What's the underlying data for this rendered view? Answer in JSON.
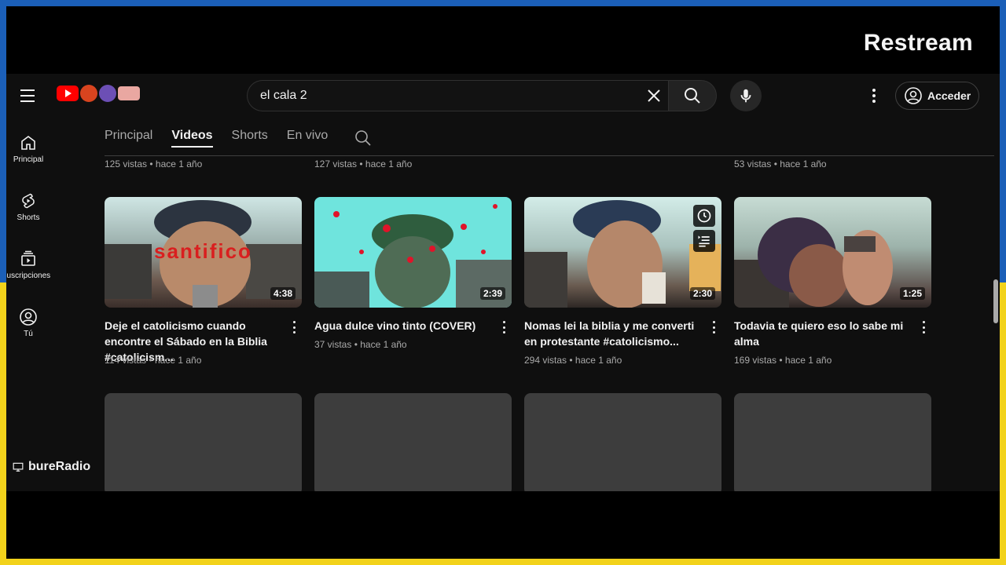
{
  "overlay": {
    "brand": "Restream",
    "channel": "bureRadio"
  },
  "search": {
    "value": "el cala 2"
  },
  "header": {
    "signin_label": "Acceder"
  },
  "sidebar": {
    "items": [
      {
        "label": "Principal",
        "icon": "home-icon"
      },
      {
        "label": "Shorts",
        "icon": "shorts-icon"
      },
      {
        "label": "Suscripciones",
        "icon": "subscriptions-icon"
      },
      {
        "label": "Tú",
        "icon": "account-icon"
      }
    ]
  },
  "tabs": [
    {
      "label": "Principal",
      "active": false
    },
    {
      "label": "Videos",
      "active": true
    },
    {
      "label": "Shorts",
      "active": false
    },
    {
      "label": "En vivo",
      "active": false
    }
  ],
  "prev_row_meta": [
    "125 vistas • hace 1 año",
    "127 vistas • hace 1 año",
    "",
    "53 vistas • hace 1 año"
  ],
  "videos": [
    {
      "title": "Deje el catolicismo cuando encontre el Sábado en la Biblia #catolicism...",
      "meta": "114 vistas • hace 1 año",
      "duration": "4:38",
      "thumb_text": "santifico"
    },
    {
      "title": "Agua dulce vino tinto (COVER)",
      "meta": "37 vistas • hace 1 año",
      "duration": "2:39"
    },
    {
      "title": "Nomas lei la biblia y me converti en protestante #catolicismo...",
      "meta": "294 vistas • hace 1 año",
      "duration": "2:30"
    },
    {
      "title": "Todavia te quiero eso lo sabe mi alma",
      "meta": "169 vistas • hace 1 año",
      "duration": "1:25"
    }
  ],
  "colors": {
    "frame_blue": "#1b5fb8",
    "frame_yellow": "#f2d21b",
    "yt_red": "#ff0000",
    "bg": "#0f0f0f"
  }
}
